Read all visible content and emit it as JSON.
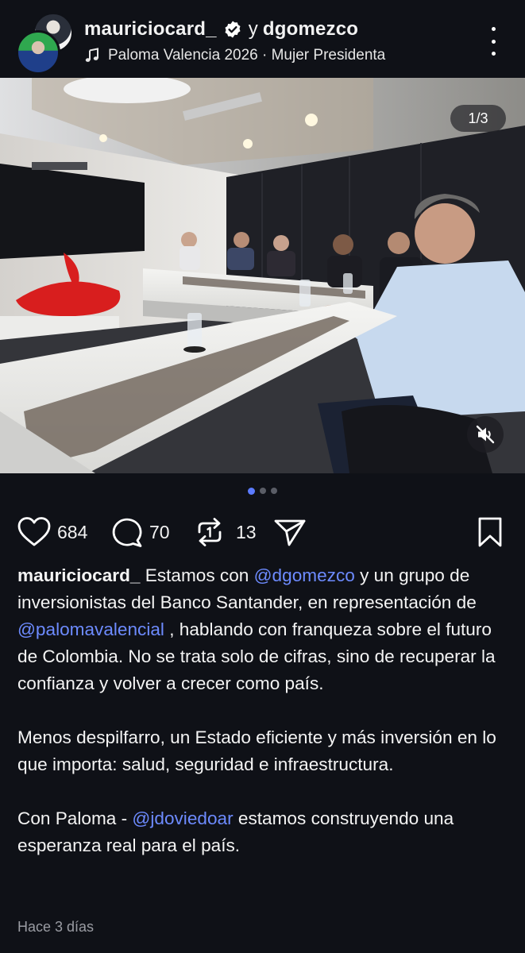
{
  "header": {
    "author": "mauriciocard_",
    "conjunction": "y",
    "coauthor": "dgomezco",
    "music_text": "Paloma Valencia 2026 · Mujer Presidenta"
  },
  "media": {
    "counter": "1/3",
    "total_images": 3,
    "active_index": 1
  },
  "actions": {
    "likes": "684",
    "comments": "70",
    "reposts": "13"
  },
  "caption": {
    "author": "mauriciocard_",
    "p1_a": " Estamos con ",
    "mention1": "@dgomezco",
    "p1_b": " y un grupo de inversionistas del Banco Santander, en representación de ",
    "mention2": "@palomavalencial",
    "p1_c": " , hablando con franqueza sobre el futuro de Colombia. No se trata solo de cifras, sino de recuperar la confianza y volver a crecer como país.",
    "p2": "Menos despilfarro, un Estado eficiente y más inversión en lo que importa: salud, seguridad e infraestructura.",
    "p3_a": "Con Paloma - ",
    "mention3": "@jdoviedoar",
    "p3_b": " estamos construyendo una esperanza real para el país."
  },
  "timestamp": "Hace 3 días",
  "colors": {
    "background": "#0f1117",
    "mention": "#6d8bff",
    "active_dot": "#5b7bff",
    "brand_red": "#d81e1e"
  }
}
